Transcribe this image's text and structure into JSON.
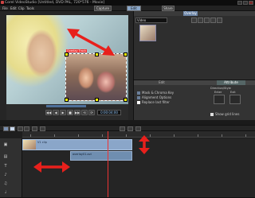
{
  "window": {
    "title": "Corel VideoStudio [Untitled, DVD PAL, 720*576 - Movie]"
  },
  "menu": {
    "items": [
      "File",
      "Edit",
      "Clip",
      "Tools"
    ],
    "steps": [
      "Capture",
      "Edit",
      "Share"
    ],
    "active_step": "Edit"
  },
  "preview": {
    "overlay_label": "Overlay Track"
  },
  "transport": {
    "buttons": [
      "◀◀",
      "◀",
      "▶",
      "■",
      "▶▶",
      "⟲",
      "⟳"
    ],
    "timecode": "0:00:04:00"
  },
  "library": {
    "tabs": [
      "",
      "",
      "",
      "",
      "Overlay",
      "",
      ""
    ],
    "dropdown_value": "Video"
  },
  "options": {
    "tabs": [
      "Edit",
      "Attribute"
    ],
    "rows": [
      "Mask & Chroma Key",
      "Alignment Options",
      "Replace last filter"
    ],
    "direction_label": "Direction/Style",
    "enter_label": "Enter",
    "exit_label": "Exit",
    "show_grid": "Show grid lines"
  },
  "timeline": {
    "video_clip_name": "V1 clip",
    "overlay_clip_name": "overlay01.avi"
  },
  "colors": {
    "accent": "#8aa7c9",
    "arrow": "#e8201c",
    "clip_video": "#8aa6c9",
    "clip_overlay": "#6f8eb0"
  }
}
